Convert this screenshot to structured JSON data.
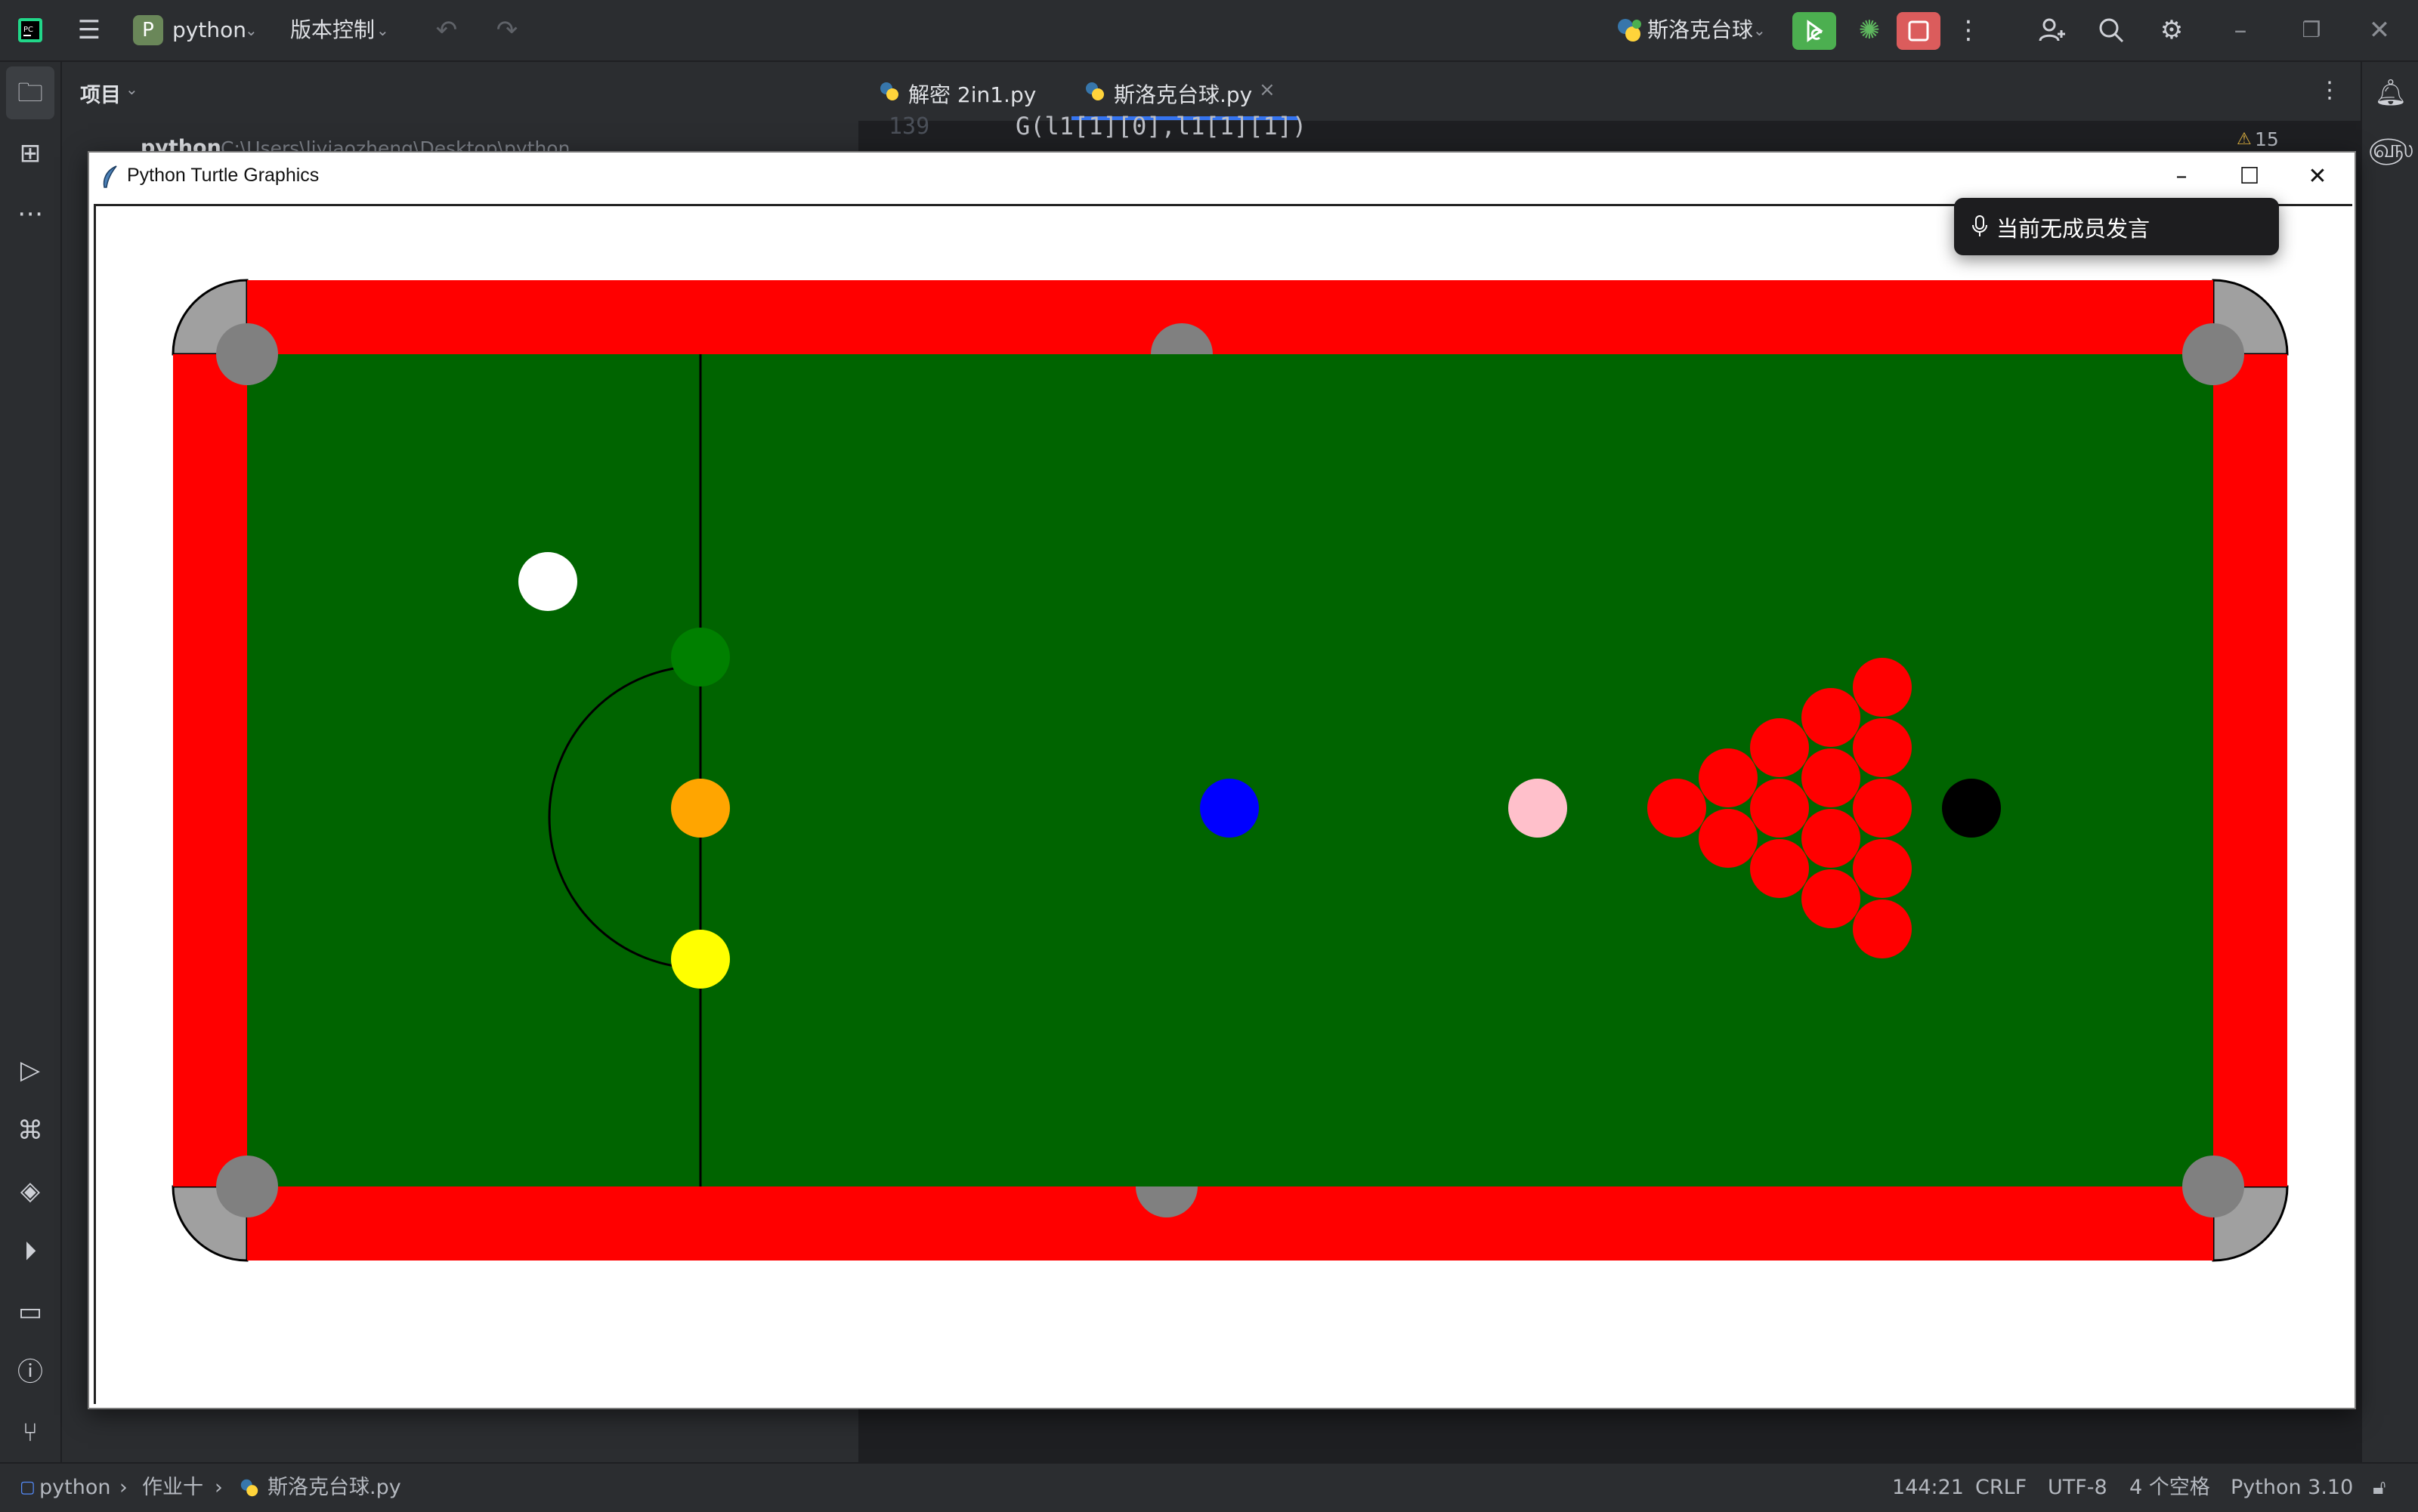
{
  "ide": {
    "project_name": "python",
    "project_badge": "P",
    "vcs_label": "版本控制",
    "run_config": "斯洛克台球",
    "colors": {
      "run_green": "#4caf50",
      "stop_red": "#db5c5c",
      "bg": "#2b2d30"
    }
  },
  "project_panel": {
    "title": "项目",
    "root_label": "python",
    "root_path": "C:\\Users\\liyiaozheng\\Desktop\\python"
  },
  "editor": {
    "tabs": [
      {
        "label": "解密 2in1.py",
        "icon": "python-file-icon"
      },
      {
        "label": "斯洛克台球.py",
        "icon": "python-file-icon",
        "active": true,
        "close": "×"
      }
    ],
    "line_number": "139",
    "code_line": "G(l1[1][0],l1[1][1])",
    "warning_count": "15"
  },
  "turtle_window": {
    "title": "Python Turtle Graphics",
    "colors": {
      "cushion": "#ff0000",
      "cloth": "#006400",
      "pocket": "#808080",
      "corner": "#a0a0a0"
    },
    "balls": [
      {
        "name": "cue-ball",
        "color": "#ffffff"
      },
      {
        "name": "green-ball",
        "color": "#008000"
      },
      {
        "name": "brown-ball",
        "color": "#ffa500"
      },
      {
        "name": "yellow-ball",
        "color": "#ffff00"
      },
      {
        "name": "blue-ball",
        "color": "#0000ff"
      },
      {
        "name": "pink-ball",
        "color": "#ffc0cb"
      },
      {
        "name": "black-ball",
        "color": "#000000"
      }
    ],
    "red_balls": 15
  },
  "toast": {
    "text": "当前无成员发言",
    "icon": "microphone-icon"
  },
  "status_bar": {
    "breadcrumb": [
      "python",
      "作业十",
      "斯洛克台球.py"
    ],
    "position": "144:21",
    "line_ending": "CRLF",
    "encoding": "UTF-8",
    "indent": "4 个空格",
    "interpreter": "Python 3.10"
  }
}
